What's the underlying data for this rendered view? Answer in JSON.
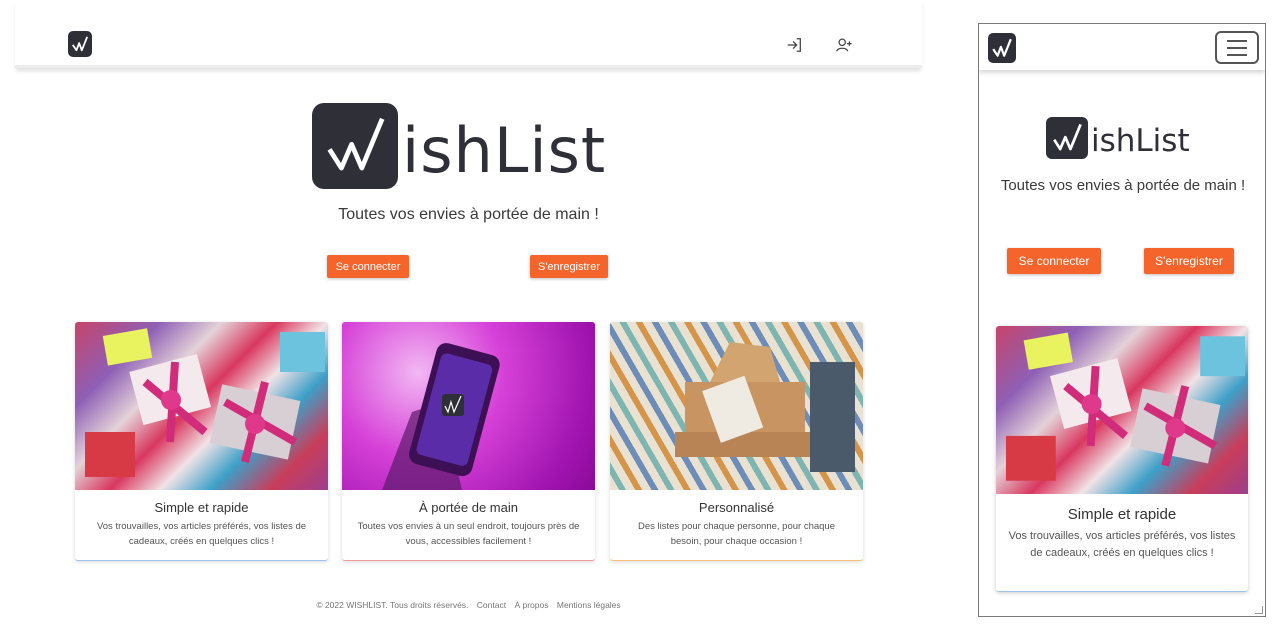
{
  "brand": {
    "logo_letter": "W",
    "name_rest": "ishList"
  },
  "header": {
    "login_icon": "login-arrow-icon",
    "register_icon": "user-plus-icon",
    "menu_icon": "hamburger-menu-icon"
  },
  "hero": {
    "tagline": "Toutes vos envies à portée de main !",
    "login_label": "Se connecter",
    "register_label": "S'enregistrer"
  },
  "cards": [
    {
      "title": "Simple et rapide",
      "description": "Vos trouvailles, vos articles préférés, vos listes de cadeaux, créés en quelques clics !",
      "image": "wrapped-gifts-image",
      "accent": "#9fc3e8"
    },
    {
      "title": "À portée de main",
      "description": "Toutes vos envies à un seul endroit, toujours près de vous, accessibles facilement !",
      "image": "phone-app-image",
      "accent": "#f29b9b"
    },
    {
      "title": "Personnalisé",
      "description": "Des listes pour chaque personne, pour chaque besoin, pour chaque occasion !",
      "image": "gift-box-tag-image",
      "accent": "#f7c27b"
    }
  ],
  "footer": {
    "copyright": "© 2022 WISHLIST. Tous droits réservés.",
    "links": [
      "Contact",
      "À propos",
      "Mentions légales"
    ]
  },
  "colors": {
    "button": "#f5642a",
    "logo_bg": "#2f2f38"
  }
}
